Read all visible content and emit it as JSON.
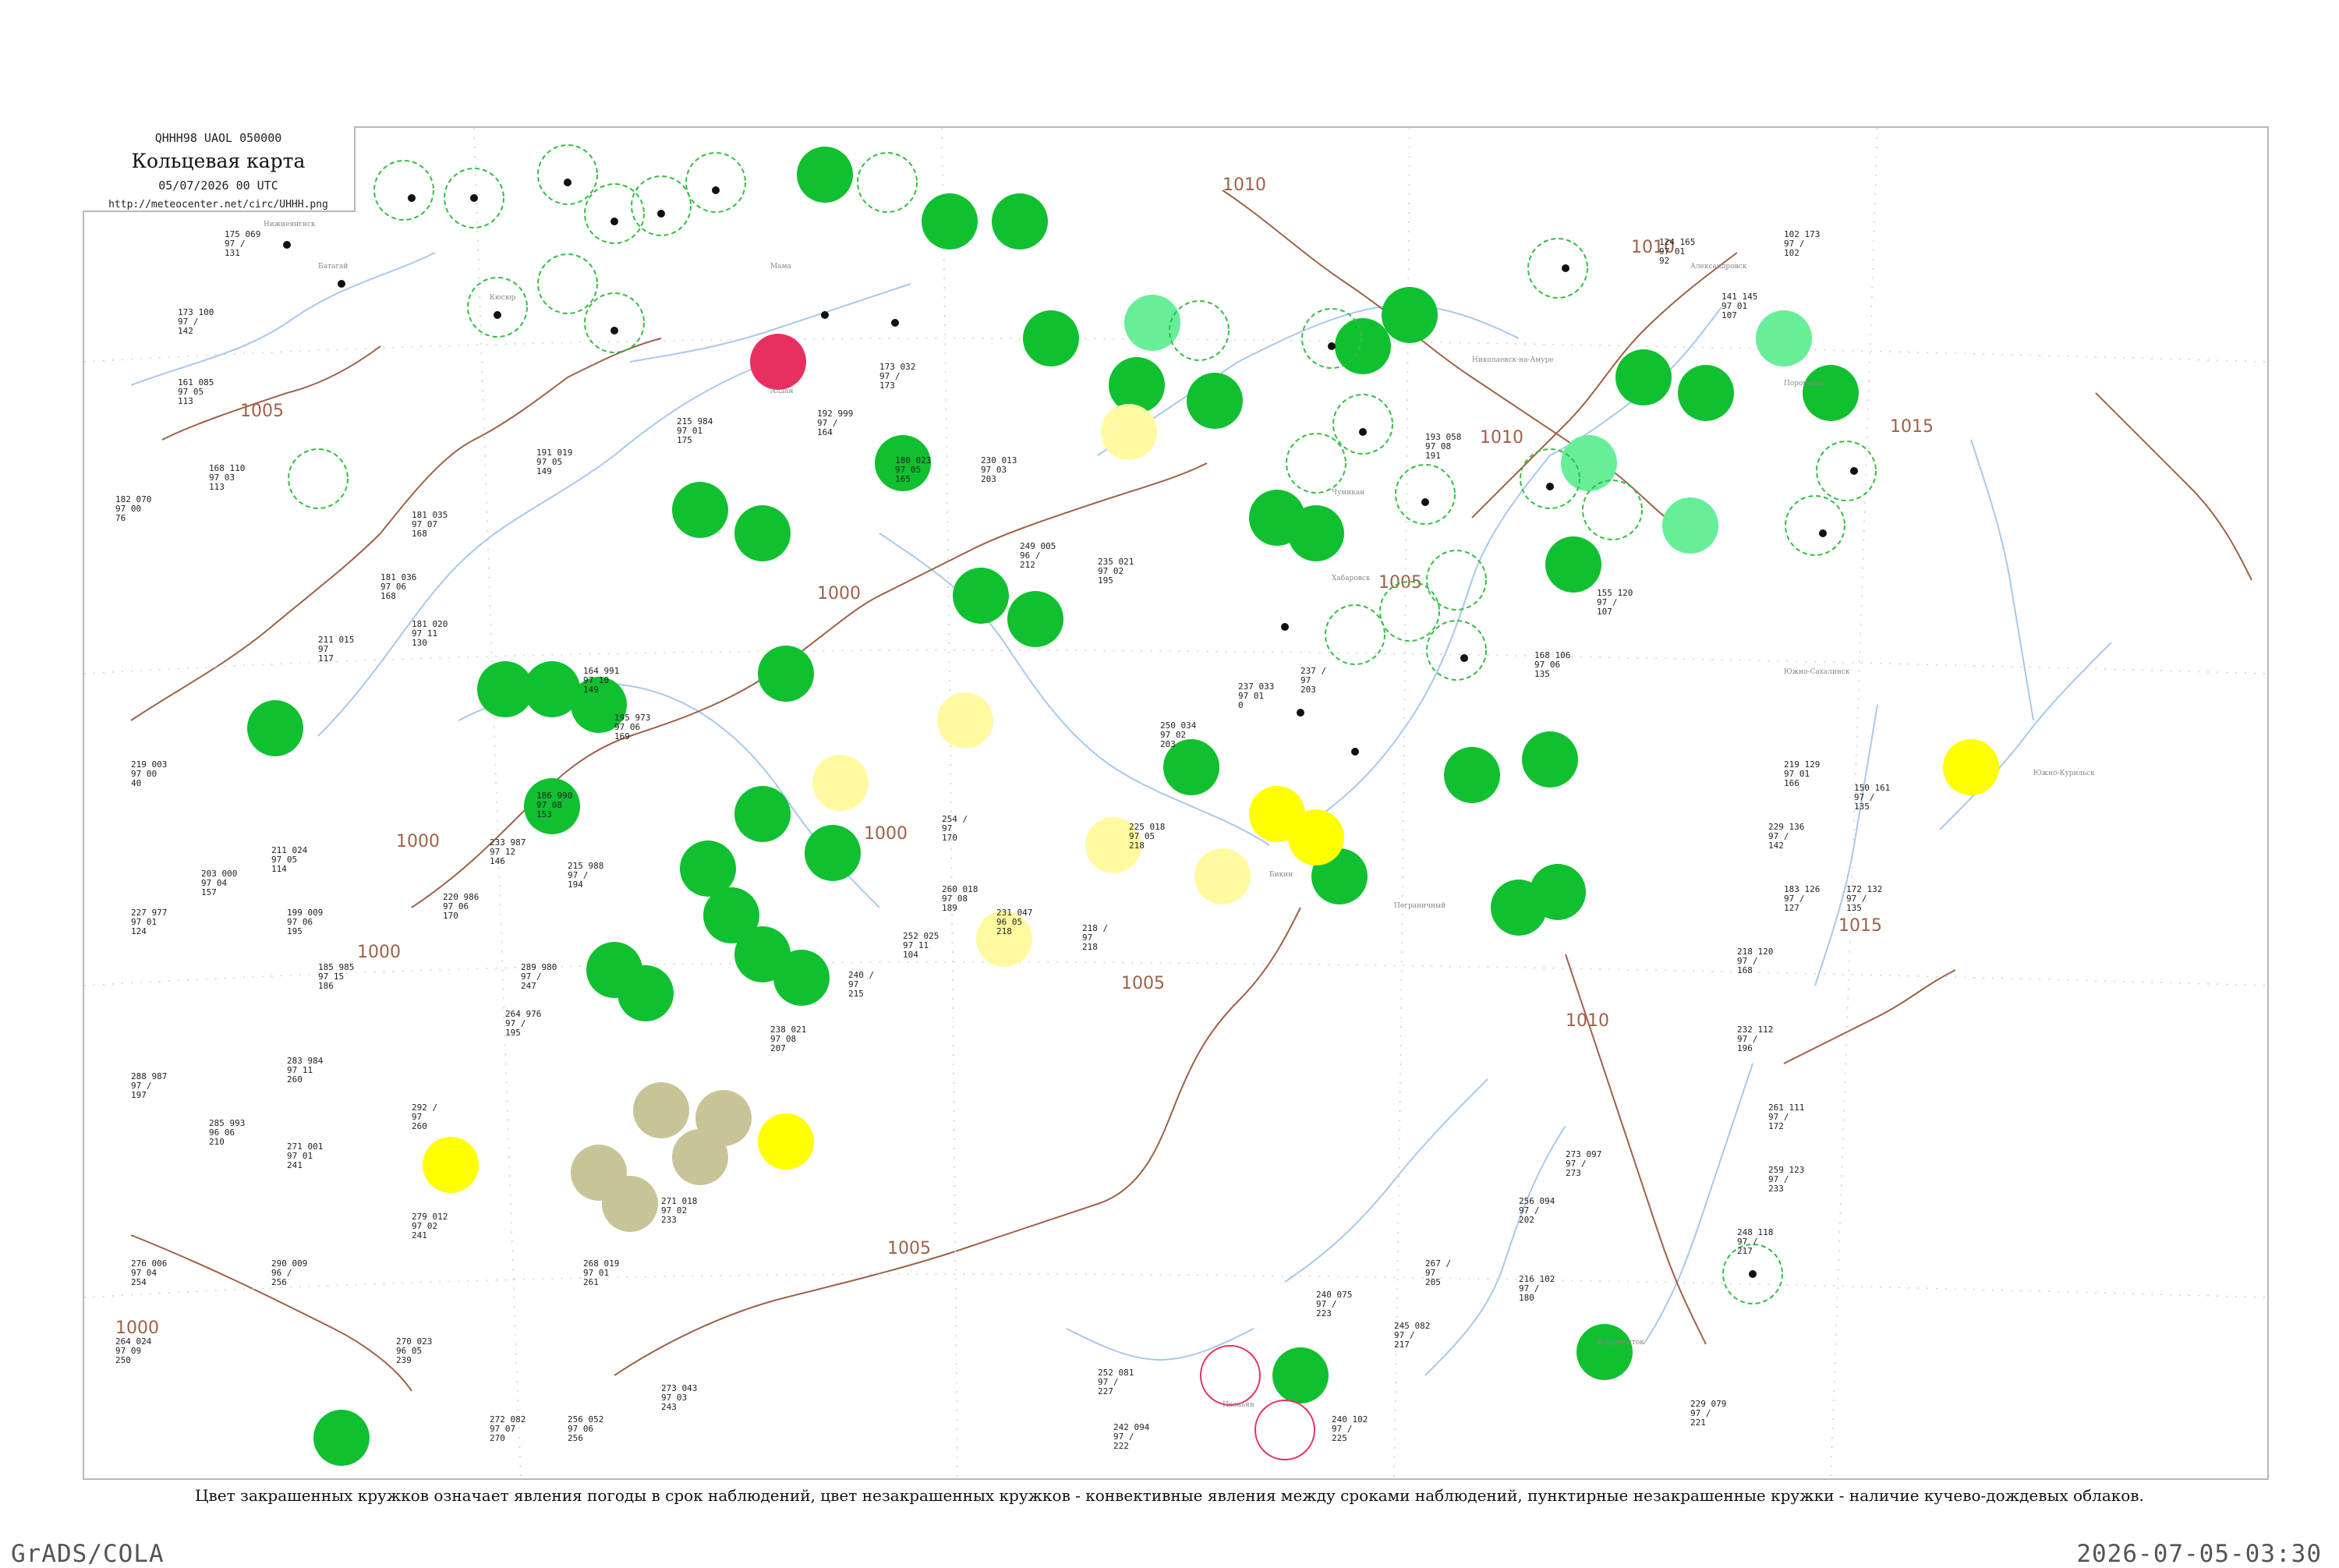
{
  "header": {
    "code": "QHHH98  UAOL  050000",
    "title": "Кольцевая карта",
    "date": "05/07/2026 00 UTC",
    "url": "http://meteocenter.net/circ/UHHH.png"
  },
  "isobars": [
    "1000",
    "1005",
    "1010",
    "1015"
  ],
  "legend_note": "Цвет закрашенных кружков означает явления погоды в срок наблюдений, цвет незакрашенных кружков - конвективные явления между сроками наблюдений, пунктирные незакрашенные кружки - наличие кучево-дождевых облаков.",
  "footer": {
    "left": "GrADS/COLA",
    "right": "2026-07-05-03:30"
  },
  "colors": {
    "rain": "#10c030",
    "light_rain": "#66ee99",
    "thunder": "#e83060",
    "haze": "#ffff00",
    "light_haze": "#fffaa0",
    "dust": "#c8c498",
    "cb_ring": "#30c040",
    "isobar": "#a06048",
    "river": "#a8c8ee",
    "frame": "#b8b8b8"
  }
}
